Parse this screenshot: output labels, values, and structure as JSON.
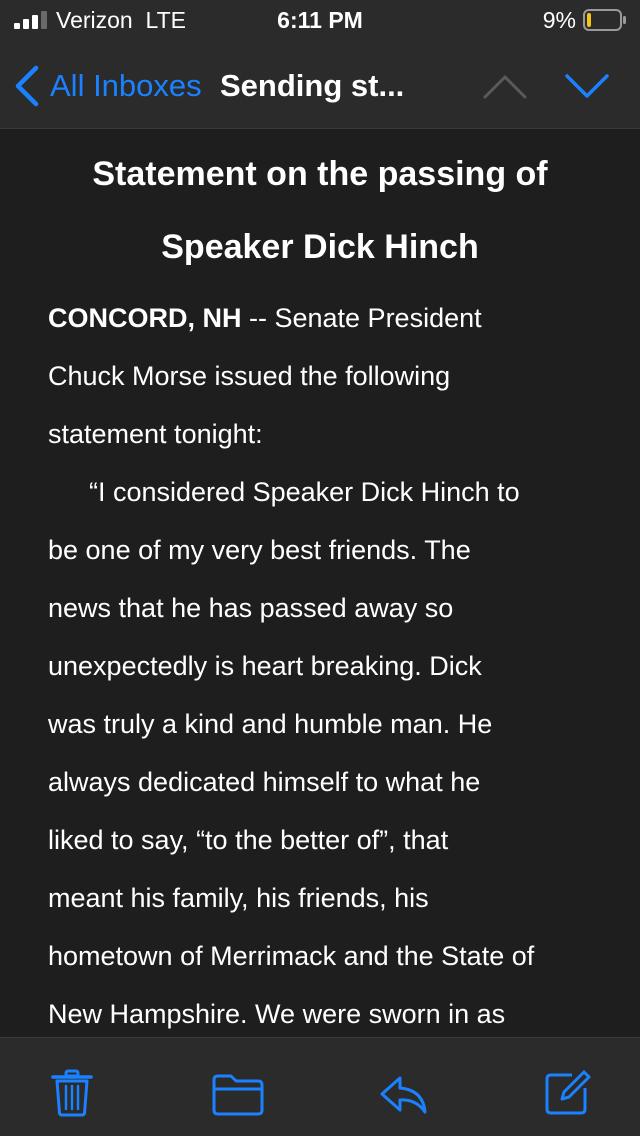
{
  "status_bar": {
    "carrier": "Verizon  LTE",
    "time": "6:11 PM",
    "battery_percent": "9%"
  },
  "nav": {
    "back_label": "All Inboxes",
    "title": "Sending st...",
    "back_icon": "chevron-left-icon",
    "prev_icon": "chevron-up-icon",
    "next_icon": "chevron-down-icon"
  },
  "email": {
    "title_lines": [
      "Statement on the passing of",
      "Speaker Dick Hinch"
    ],
    "dateline": "CONCORD, NH",
    "lines": [
      " -- Senate President",
      "Chuck Morse issued the following",
      "statement tonight:",
      "“I considered Speaker Dick Hinch to",
      "be one of my very best friends.  The",
      "news that he has passed away so",
      "unexpectedly is heart breaking.  Dick",
      "was truly a kind and humble man. He",
      "always dedicated himself to what he",
      "liked to say,  “to the better of”, that",
      "meant his family, his friends, his",
      "hometown of Merrimack and the State of",
      "New Hampshire.  We were sworn in as"
    ]
  },
  "toolbar": {
    "trash_icon": "trash-icon",
    "folder_icon": "folder-icon",
    "reply_icon": "reply-icon",
    "compose_icon": "compose-icon"
  },
  "colors": {
    "accent": "#1a82ff",
    "background": "#1e1e1e",
    "bar_background": "#2b2b2b",
    "battery_low": "#f5c518"
  }
}
